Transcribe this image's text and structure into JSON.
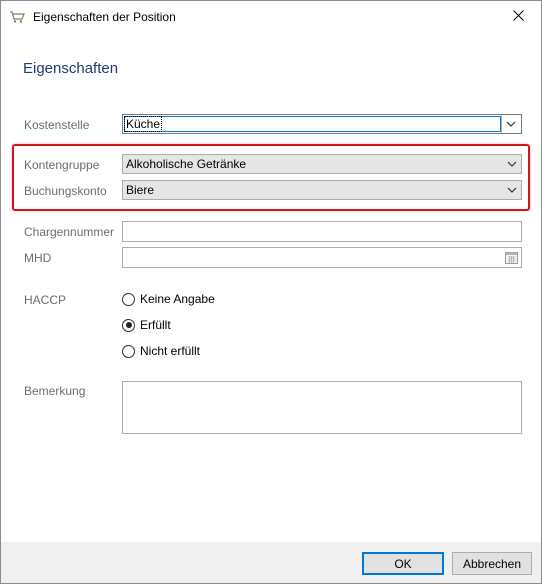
{
  "window": {
    "title": "Eigenschaften der Position",
    "app_icon": "cart-icon",
    "close_icon": "close-icon"
  },
  "section": {
    "heading": "Eigenschaften"
  },
  "fields": {
    "kostenstelle": {
      "label": "Kostenstelle",
      "value": "Küche"
    },
    "kontengruppe": {
      "label": "Kontengruppe",
      "value": "Alkoholische Getränke"
    },
    "buchungskonto": {
      "label": "Buchungskonto",
      "value": "Biere"
    },
    "chargennummer": {
      "label": "Chargennummer",
      "value": ""
    },
    "mhd": {
      "label": "MHD",
      "value": "",
      "icon": "calendar-icon"
    },
    "haccp": {
      "label": "HACCP",
      "options": [
        "Keine Angabe",
        "Erfüllt",
        "Nicht erfüllt"
      ],
      "selected": "Erfüllt"
    },
    "bemerkung": {
      "label": "Bemerkung",
      "value": ""
    }
  },
  "highlight_color": "#d0171f",
  "buttons": {
    "ok": "OK",
    "cancel": "Abbrechen"
  }
}
